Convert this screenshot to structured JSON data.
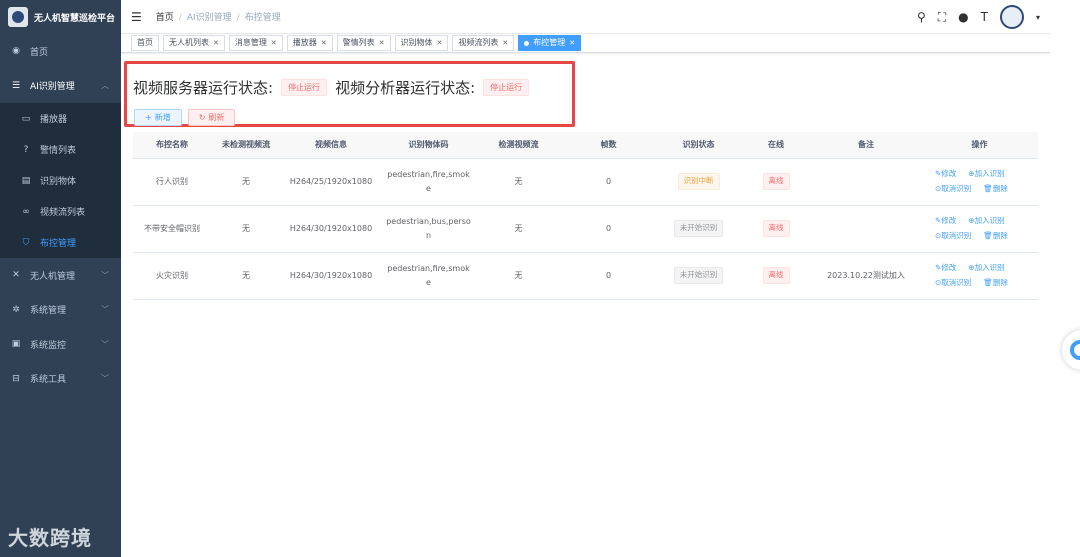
{
  "app": {
    "title": "无人机智慧巡检平台"
  },
  "sidebar": {
    "items": [
      {
        "label": "首页",
        "icon": "dashboard-icon"
      },
      {
        "label": "AI识别管理",
        "icon": "list-icon",
        "open": true,
        "children": [
          {
            "label": "播放器",
            "icon": "monitor-icon"
          },
          {
            "label": "警情列表",
            "icon": "question-icon"
          },
          {
            "label": "识别物体",
            "icon": "document-icon"
          },
          {
            "label": "视频流列表",
            "icon": "infinity-icon"
          },
          {
            "label": "布控管理",
            "icon": "shield-icon",
            "active": true
          }
        ]
      },
      {
        "label": "无人机管理",
        "icon": "tools-icon"
      },
      {
        "label": "系统管理",
        "icon": "gear-icon"
      },
      {
        "label": "系统监控",
        "icon": "monitor-icon"
      },
      {
        "label": "系统工具",
        "icon": "toolbox-icon"
      }
    ]
  },
  "breadcrumb": {
    "home": "首页",
    "level1": "AI识别管理",
    "level2": "布控管理"
  },
  "tags": [
    "首页",
    "无人机列表",
    "消息管理",
    "播放器",
    "警情列表",
    "识别物体",
    "视频流列表",
    "布控管理"
  ],
  "status": {
    "server_label": "视频服务器运行状态:",
    "server_value": "停止运行",
    "analyzer_label": "视频分析器运行状态:",
    "analyzer_value": "停止运行"
  },
  "buttons": {
    "add": "新增",
    "refresh": "刷新"
  },
  "table": {
    "headers": [
      "布控名称",
      "未检测视频流",
      "视频信息",
      "识别物体码",
      "检测视频流",
      "帧数",
      "识别状态",
      "在线",
      "备注",
      "操作"
    ],
    "rows": [
      {
        "name": "行人识别",
        "undetected": "无",
        "video_info": "H264/25/1920x1080",
        "objects": "pedestrian,fire,smoke",
        "detected": "无",
        "frames": "0",
        "state": "识别中断",
        "online": "离线",
        "remark": ""
      },
      {
        "name": "不带安全帽识别",
        "undetected": "无",
        "video_info": "H264/30/1920x1080",
        "objects": "pedestrian,bus,person",
        "detected": "无",
        "frames": "0",
        "state": "未开始识别",
        "online": "离线",
        "remark": ""
      },
      {
        "name": "火灾识别",
        "undetected": "无",
        "video_info": "H264/30/1920x1080",
        "objects": "pedestrian,fire,smoke",
        "detected": "无",
        "frames": "0",
        "state": "未开始识别",
        "online": "离线",
        "remark": "2023.10.22测试加入"
      }
    ],
    "ops": {
      "edit": "修改",
      "add": "加入识别",
      "cancel": "取消识别",
      "delete": "删除"
    }
  },
  "watermark": "大数跨境",
  "colors": {
    "sidebar": "#304156",
    "accent": "#409eff",
    "danger": "#f56c6c",
    "highlight": "#e54646"
  }
}
